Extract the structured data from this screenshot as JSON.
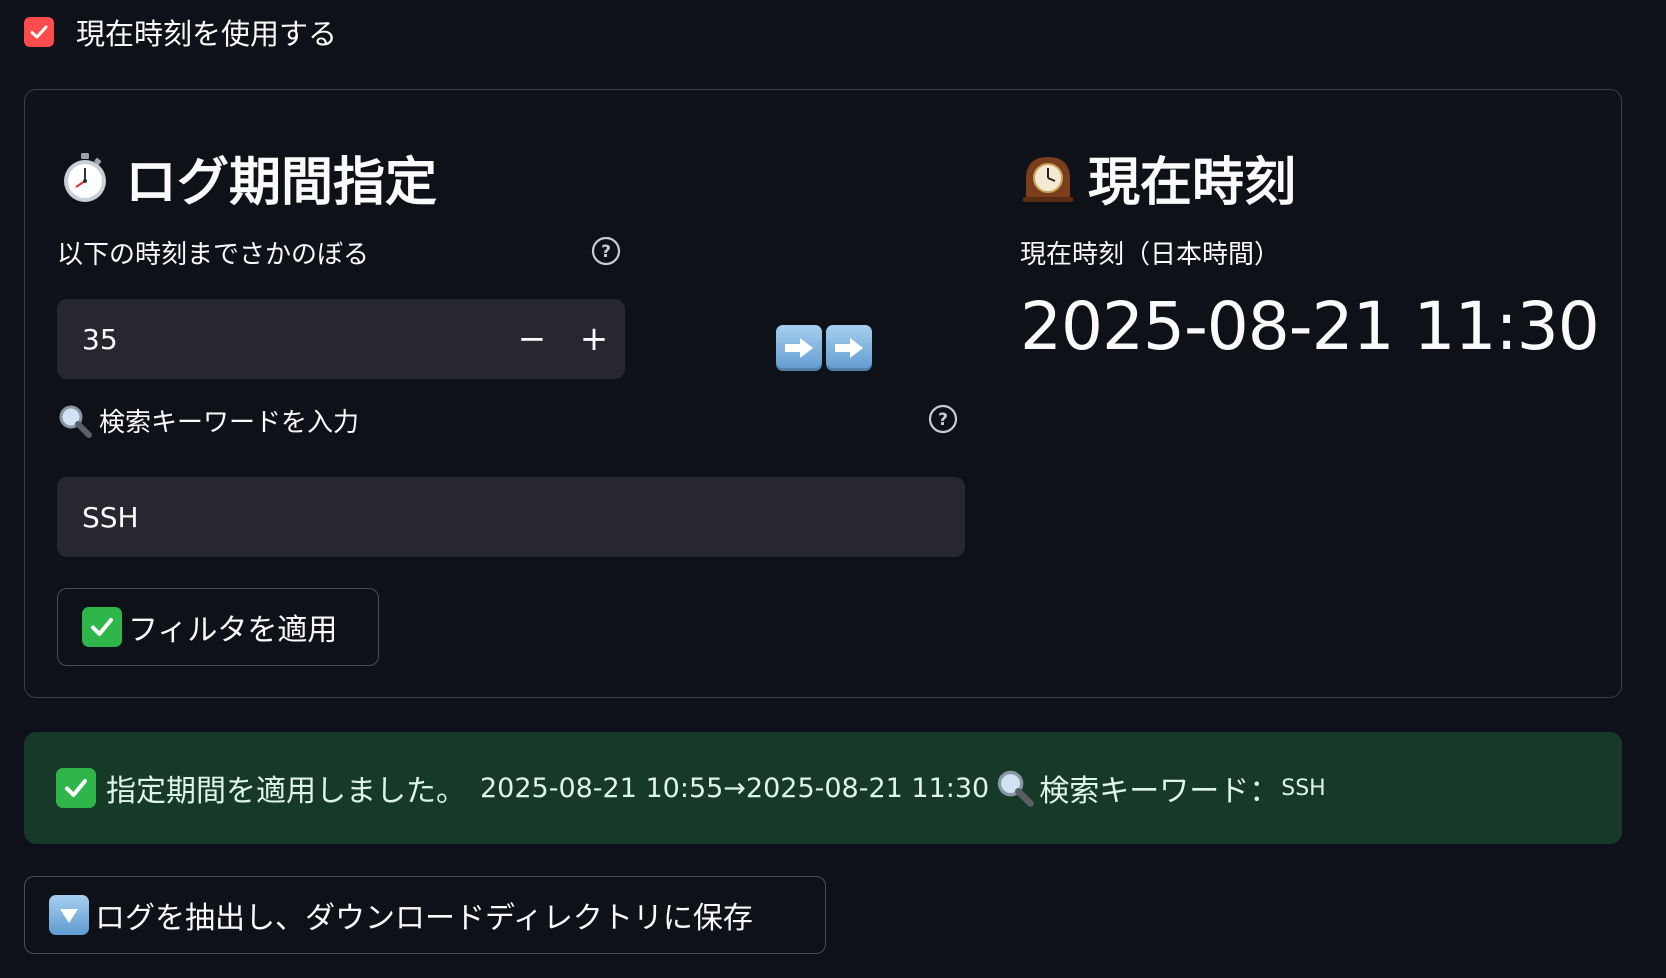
{
  "use_current_time": {
    "label": "現在時刻を使用する",
    "checked": true
  },
  "log_period": {
    "heading": "ログ期間指定",
    "heading_icon": "stopwatch-icon",
    "lookback": {
      "label": "以下の時刻までさかのぼる",
      "value": "35",
      "decrement": "−",
      "increment": "+"
    },
    "keyword": {
      "label": "検索キーワードを入力",
      "label_icon": "magnifier-icon",
      "value": "SSH"
    },
    "apply_button": {
      "label": "フィルタを適用",
      "icon": "check-mark-icon"
    }
  },
  "arrows_icon": "right-arrow-icon",
  "current_time": {
    "heading": "現在時刻",
    "heading_icon": "mantelpiece-clock-icon",
    "label": "現在時刻（日本時間）",
    "value": "2025-08-21 11:30"
  },
  "alert": {
    "message": "指定期間を適用しました。",
    "range": "2025-08-21 10:55→2025-08-21 11:30",
    "keyword_label": "検索キーワード：",
    "keyword": "SSH"
  },
  "extract_button": {
    "label": "ログを抽出し、ダウンロードディレクトリに保存",
    "icon": "down-arrow-icon"
  },
  "colors": {
    "background": "#0e1117",
    "accent": "#ff4b4b",
    "input": "#262730",
    "alert": "#173928"
  }
}
